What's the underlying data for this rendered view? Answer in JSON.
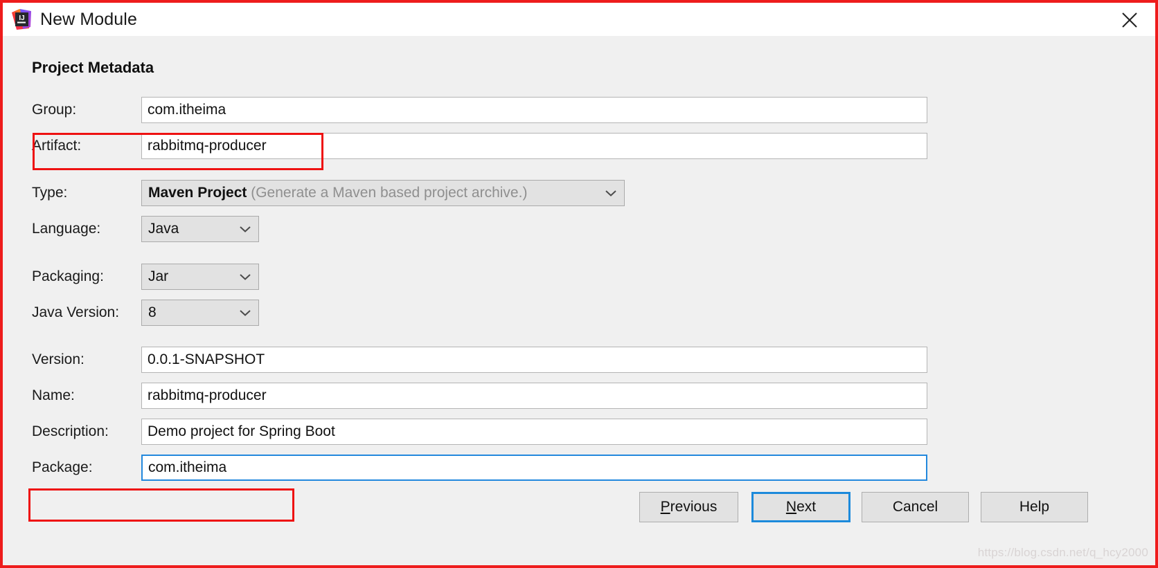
{
  "window": {
    "title": "New Module",
    "icon": "intellij-idea-logo",
    "close_icon": "close-icon"
  },
  "section": {
    "title": "Project Metadata"
  },
  "fields": {
    "group": {
      "label": "Group:",
      "value": "com.itheima"
    },
    "artifact": {
      "label": "Artifact:",
      "value": "rabbitmq-producer"
    },
    "type": {
      "label": "Type:",
      "value": "Maven Project",
      "hint": "(Generate a Maven based project archive.)"
    },
    "language": {
      "label": "Language:",
      "value": "Java"
    },
    "packaging": {
      "label": "Packaging:",
      "value": "Jar"
    },
    "java_version": {
      "label": "Java Version:",
      "value": "8"
    },
    "version": {
      "label": "Version:",
      "value": "0.0.1-SNAPSHOT"
    },
    "name": {
      "label": "Name:",
      "value": "rabbitmq-producer"
    },
    "description": {
      "label": "Description:",
      "value": "Demo project for Spring Boot"
    },
    "package": {
      "label": "Package:",
      "value": "com.itheima"
    }
  },
  "buttons": {
    "previous": {
      "prefix": "",
      "mnemonic": "P",
      "suffix": "revious"
    },
    "next": {
      "prefix": "",
      "mnemonic": "N",
      "suffix": "ext"
    },
    "cancel": {
      "label": "Cancel"
    },
    "help": {
      "label": "Help"
    }
  },
  "watermark": {
    "text": "https://blog.csdn.net/q_hcy2000"
  },
  "colors": {
    "annotation_red": "#ee1111",
    "focus_blue": "#2288dd",
    "default_button_blue": "#1c8adb",
    "dialog_bg": "#f0f0f0",
    "titlebar_bg": "#ffffff"
  }
}
